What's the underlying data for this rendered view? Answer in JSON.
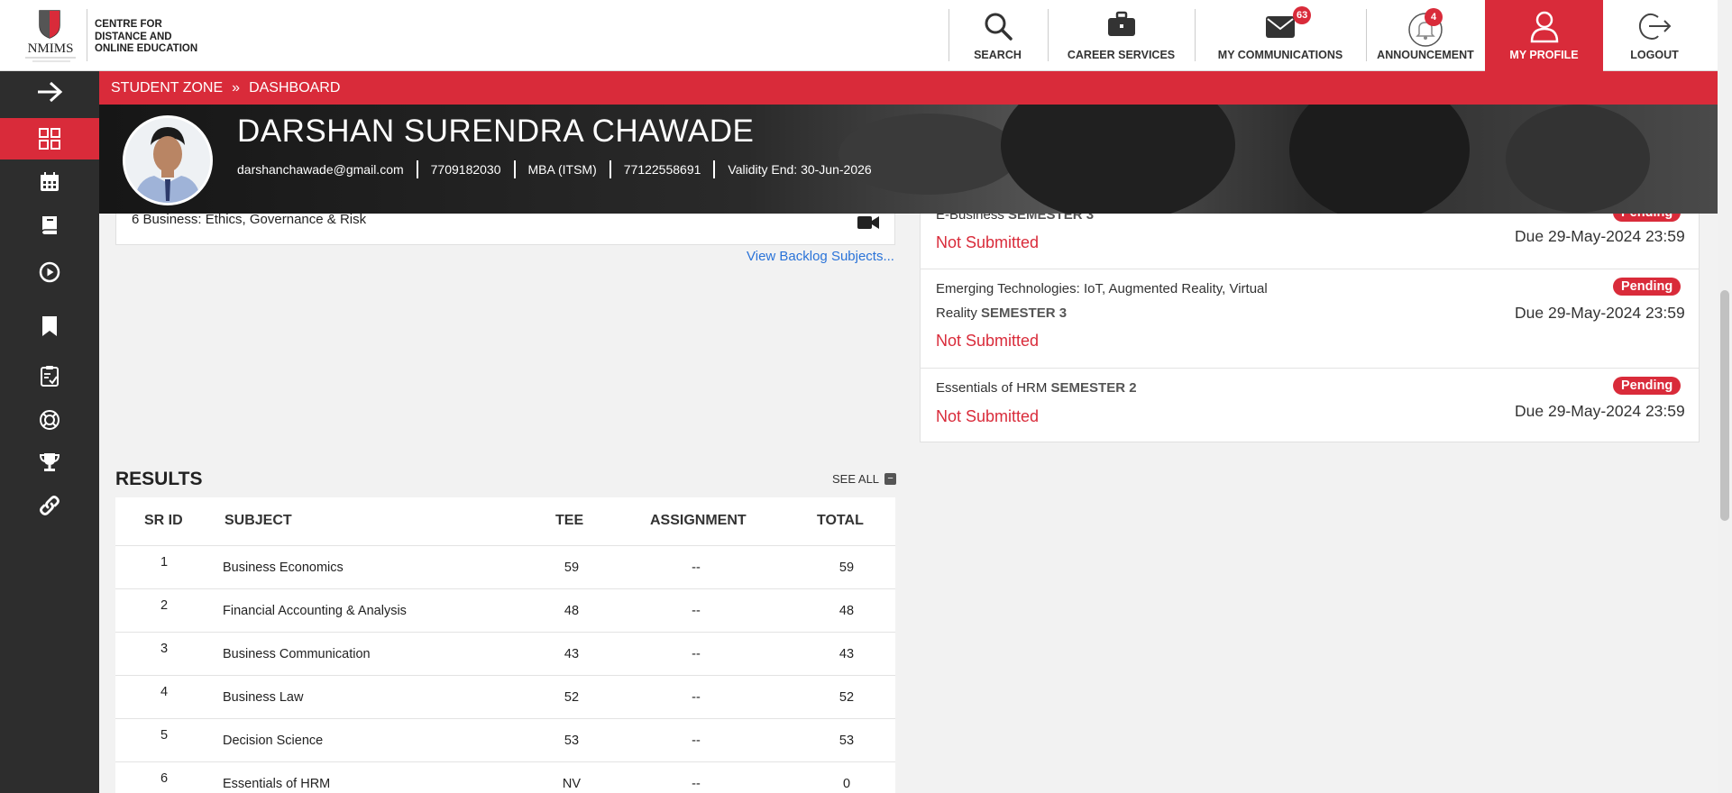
{
  "header": {
    "logo_line1": "CENTRE FOR",
    "logo_line2": "DISTANCE AND",
    "logo_line3": "ONLINE EDUCATION",
    "logo_brand": "NMIMS",
    "nav": {
      "search": "SEARCH",
      "career": "CAREER SERVICES",
      "communications": "MY COMMUNICATIONS",
      "communications_count": "63",
      "announcement": "ANNOUNCEMENT",
      "announcement_count": "4",
      "profile": "MY PROFILE",
      "logout": "LOGOUT"
    }
  },
  "breadcrumb": {
    "zone": "STUDENT ZONE",
    "separator": "»",
    "page": "DASHBOARD"
  },
  "student": {
    "name": "DARSHAN SURENDRA CHAWADE",
    "email": "darshanchawade@gmail.com",
    "phone": "7709182030",
    "program": "MBA (ITSM)",
    "sap_id": "77122558691",
    "validity": "Validity End: 30-Jun-2026"
  },
  "subjects": {
    "partial_item": "6 Business: Ethics, Governance & Risk",
    "backlog_link": "View Backlog Subjects..."
  },
  "assignments": [
    {
      "subject": "E-Business",
      "semester": "SEMESTER 3",
      "status": "Not Submitted",
      "badge": "Pending",
      "due": "Due 29-May-2024 23:59"
    },
    {
      "subject_line1": "Emerging Technologies: IoT, Augmented Reality, Virtual",
      "subject_line2": "Reality",
      "semester": "SEMESTER 3",
      "status": "Not Submitted",
      "badge": "Pending",
      "due": "Due 29-May-2024 23:59"
    },
    {
      "subject": "Essentials of HRM",
      "semester": "SEMESTER 2",
      "status": "Not Submitted",
      "badge": "Pending",
      "due": "Due 29-May-2024 23:59"
    }
  ],
  "results": {
    "title": "RESULTS",
    "see_all": "SEE ALL",
    "columns": [
      "SR ID",
      "SUBJECT",
      "TEE",
      "ASSIGNMENT",
      "TOTAL"
    ],
    "rows": [
      {
        "id": "1",
        "subject": "Business Economics",
        "tee": "59",
        "assignment": "--",
        "total": "59"
      },
      {
        "id": "2",
        "subject": "Financial Accounting & Analysis",
        "tee": "48",
        "assignment": "--",
        "total": "48"
      },
      {
        "id": "3",
        "subject": "Business Communication",
        "tee": "43",
        "assignment": "--",
        "total": "43"
      },
      {
        "id": "4",
        "subject": "Business Law",
        "tee": "52",
        "assignment": "--",
        "total": "52"
      },
      {
        "id": "5",
        "subject": "Decision Science",
        "tee": "53",
        "assignment": "--",
        "total": "53"
      },
      {
        "id": "6",
        "subject": "Essentials of HRM",
        "tee": "NV",
        "assignment": "--",
        "total": "0"
      }
    ]
  },
  "colors": {
    "accent": "#d92b3a",
    "sidebar": "#2d2d2d",
    "link": "#2a73d8"
  }
}
